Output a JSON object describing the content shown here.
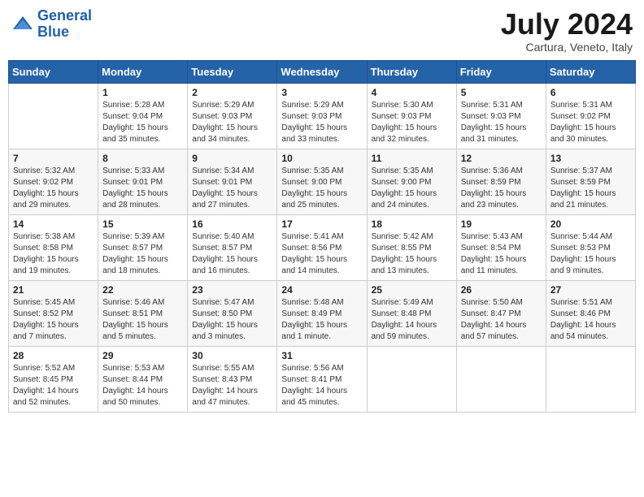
{
  "header": {
    "logo_line1": "General",
    "logo_line2": "Blue",
    "month": "July 2024",
    "location": "Cartura, Veneto, Italy"
  },
  "weekdays": [
    "Sunday",
    "Monday",
    "Tuesday",
    "Wednesday",
    "Thursday",
    "Friday",
    "Saturday"
  ],
  "weeks": [
    [
      {
        "day": "",
        "info": ""
      },
      {
        "day": "1",
        "info": "Sunrise: 5:28 AM\nSunset: 9:04 PM\nDaylight: 15 hours\nand 35 minutes."
      },
      {
        "day": "2",
        "info": "Sunrise: 5:29 AM\nSunset: 9:03 PM\nDaylight: 15 hours\nand 34 minutes."
      },
      {
        "day": "3",
        "info": "Sunrise: 5:29 AM\nSunset: 9:03 PM\nDaylight: 15 hours\nand 33 minutes."
      },
      {
        "day": "4",
        "info": "Sunrise: 5:30 AM\nSunset: 9:03 PM\nDaylight: 15 hours\nand 32 minutes."
      },
      {
        "day": "5",
        "info": "Sunrise: 5:31 AM\nSunset: 9:03 PM\nDaylight: 15 hours\nand 31 minutes."
      },
      {
        "day": "6",
        "info": "Sunrise: 5:31 AM\nSunset: 9:02 PM\nDaylight: 15 hours\nand 30 minutes."
      }
    ],
    [
      {
        "day": "7",
        "info": "Sunrise: 5:32 AM\nSunset: 9:02 PM\nDaylight: 15 hours\nand 29 minutes."
      },
      {
        "day": "8",
        "info": "Sunrise: 5:33 AM\nSunset: 9:01 PM\nDaylight: 15 hours\nand 28 minutes."
      },
      {
        "day": "9",
        "info": "Sunrise: 5:34 AM\nSunset: 9:01 PM\nDaylight: 15 hours\nand 27 minutes."
      },
      {
        "day": "10",
        "info": "Sunrise: 5:35 AM\nSunset: 9:00 PM\nDaylight: 15 hours\nand 25 minutes."
      },
      {
        "day": "11",
        "info": "Sunrise: 5:35 AM\nSunset: 9:00 PM\nDaylight: 15 hours\nand 24 minutes."
      },
      {
        "day": "12",
        "info": "Sunrise: 5:36 AM\nSunset: 8:59 PM\nDaylight: 15 hours\nand 23 minutes."
      },
      {
        "day": "13",
        "info": "Sunrise: 5:37 AM\nSunset: 8:59 PM\nDaylight: 15 hours\nand 21 minutes."
      }
    ],
    [
      {
        "day": "14",
        "info": "Sunrise: 5:38 AM\nSunset: 8:58 PM\nDaylight: 15 hours\nand 19 minutes."
      },
      {
        "day": "15",
        "info": "Sunrise: 5:39 AM\nSunset: 8:57 PM\nDaylight: 15 hours\nand 18 minutes."
      },
      {
        "day": "16",
        "info": "Sunrise: 5:40 AM\nSunset: 8:57 PM\nDaylight: 15 hours\nand 16 minutes."
      },
      {
        "day": "17",
        "info": "Sunrise: 5:41 AM\nSunset: 8:56 PM\nDaylight: 15 hours\nand 14 minutes."
      },
      {
        "day": "18",
        "info": "Sunrise: 5:42 AM\nSunset: 8:55 PM\nDaylight: 15 hours\nand 13 minutes."
      },
      {
        "day": "19",
        "info": "Sunrise: 5:43 AM\nSunset: 8:54 PM\nDaylight: 15 hours\nand 11 minutes."
      },
      {
        "day": "20",
        "info": "Sunrise: 5:44 AM\nSunset: 8:53 PM\nDaylight: 15 hours\nand 9 minutes."
      }
    ],
    [
      {
        "day": "21",
        "info": "Sunrise: 5:45 AM\nSunset: 8:52 PM\nDaylight: 15 hours\nand 7 minutes."
      },
      {
        "day": "22",
        "info": "Sunrise: 5:46 AM\nSunset: 8:51 PM\nDaylight: 15 hours\nand 5 minutes."
      },
      {
        "day": "23",
        "info": "Sunrise: 5:47 AM\nSunset: 8:50 PM\nDaylight: 15 hours\nand 3 minutes."
      },
      {
        "day": "24",
        "info": "Sunrise: 5:48 AM\nSunset: 8:49 PM\nDaylight: 15 hours\nand 1 minute."
      },
      {
        "day": "25",
        "info": "Sunrise: 5:49 AM\nSunset: 8:48 PM\nDaylight: 14 hours\nand 59 minutes."
      },
      {
        "day": "26",
        "info": "Sunrise: 5:50 AM\nSunset: 8:47 PM\nDaylight: 14 hours\nand 57 minutes."
      },
      {
        "day": "27",
        "info": "Sunrise: 5:51 AM\nSunset: 8:46 PM\nDaylight: 14 hours\nand 54 minutes."
      }
    ],
    [
      {
        "day": "28",
        "info": "Sunrise: 5:52 AM\nSunset: 8:45 PM\nDaylight: 14 hours\nand 52 minutes."
      },
      {
        "day": "29",
        "info": "Sunrise: 5:53 AM\nSunset: 8:44 PM\nDaylight: 14 hours\nand 50 minutes."
      },
      {
        "day": "30",
        "info": "Sunrise: 5:55 AM\nSunset: 8:43 PM\nDaylight: 14 hours\nand 47 minutes."
      },
      {
        "day": "31",
        "info": "Sunrise: 5:56 AM\nSunset: 8:41 PM\nDaylight: 14 hours\nand 45 minutes."
      },
      {
        "day": "",
        "info": ""
      },
      {
        "day": "",
        "info": ""
      },
      {
        "day": "",
        "info": ""
      }
    ]
  ]
}
